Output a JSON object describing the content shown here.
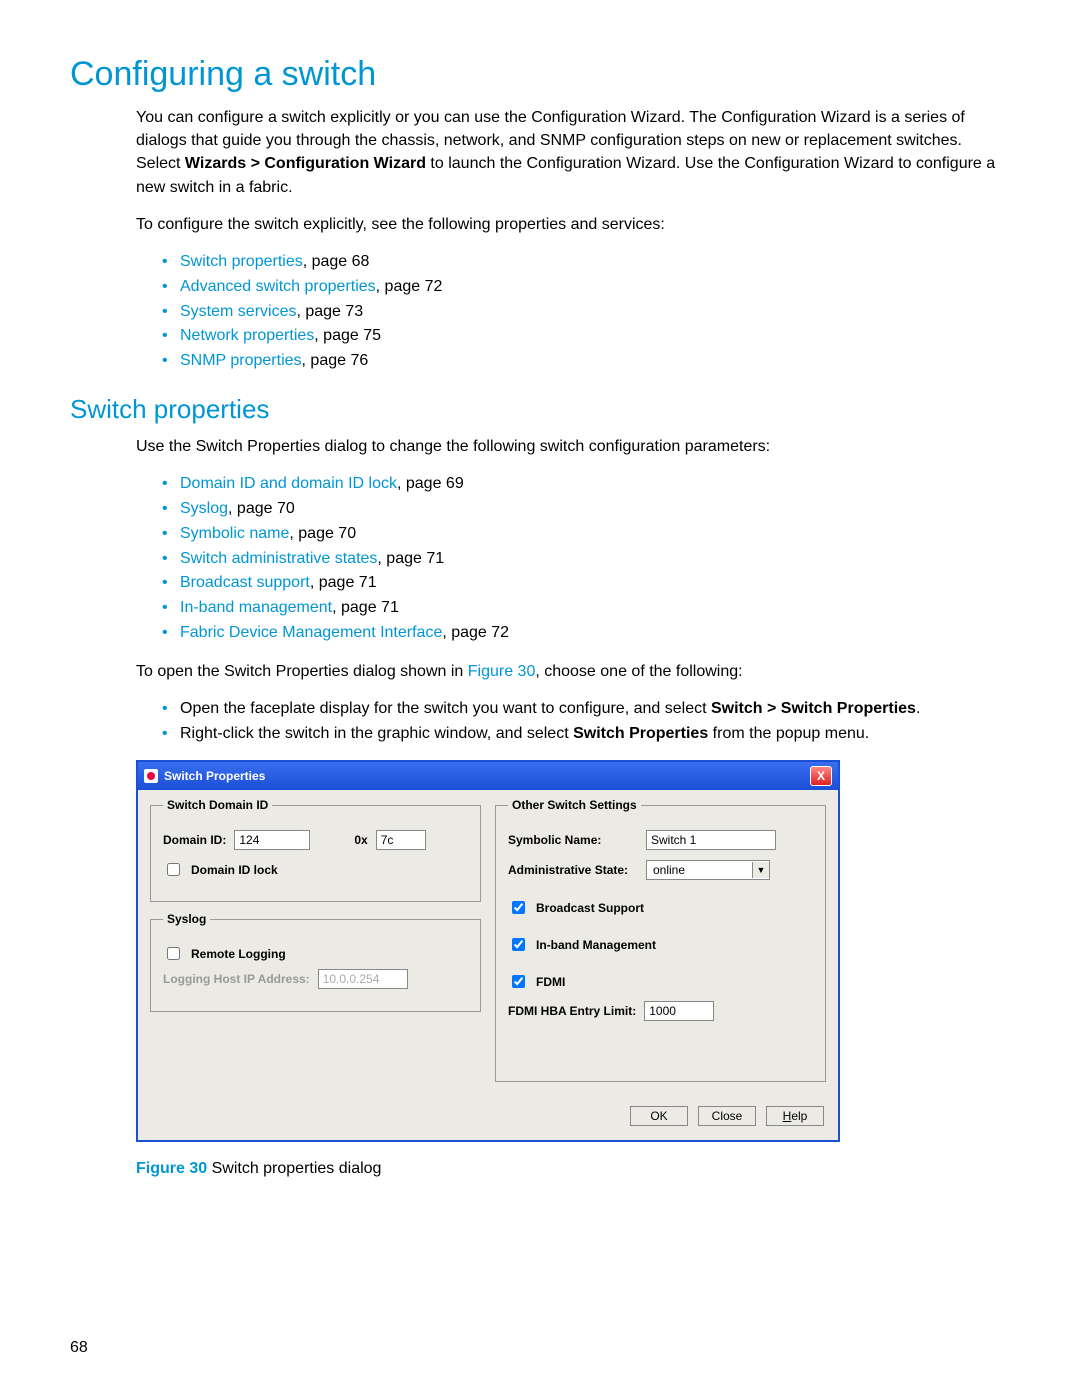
{
  "page_number": "68",
  "h1": "Configuring a switch",
  "intro_para_parts": {
    "a": "You can configure a switch explicitly or you can use the Configuration Wizard. The Configuration Wizard is a series of dialogs that guide you through the chassis, network, and SNMP configuration steps on new or replacement switches. Select ",
    "b_bold": "Wizards > Configuration Wizard",
    "c": " to launch the Configuration Wizard. Use the Configuration Wizard to configure a new switch in a fabric."
  },
  "intro_para2": "To configure the switch explicitly, see the following properties and services:",
  "links1": [
    {
      "t": "Switch properties",
      "p": ", page 68"
    },
    {
      "t": "Advanced switch properties",
      "p": ", page 72"
    },
    {
      "t": "System services",
      "p": ", page 73"
    },
    {
      "t": "Network properties",
      "p": ", page 75"
    },
    {
      "t": "SNMP properties",
      "p": ", page 76"
    }
  ],
  "h2": "Switch properties",
  "sp_intro": "Use the Switch Properties dialog to change the following switch configuration parameters:",
  "links2": [
    {
      "t": "Domain ID and domain ID lock",
      "p": ", page 69"
    },
    {
      "t": "Syslog",
      "p": ", page 70"
    },
    {
      "t": "Symbolic name",
      "p": ", page 70"
    },
    {
      "t": "Switch administrative states",
      "p": ", page 71"
    },
    {
      "t": "Broadcast support",
      "p": ", page 71"
    },
    {
      "t": "In-band management",
      "p": ", page 71"
    },
    {
      "t": "Fabric Device Management Interface",
      "p": ", page 72"
    }
  ],
  "open_para": {
    "a": "To open the Switch Properties dialog shown in ",
    "fig": "Figure 30",
    "b": ", choose one of the following:"
  },
  "open_steps": [
    {
      "a": "Open the faceplate display for the switch you want to configure, and select ",
      "bold": "Switch > Switch Properties",
      "b": "."
    },
    {
      "a": "Right-click the switch in the graphic window, and select ",
      "bold": "Switch Properties",
      "b": " from the popup menu."
    }
  ],
  "dialog": {
    "title": "Switch Properties",
    "close": "X",
    "left": {
      "domain_legend": "Switch Domain ID",
      "domain_id_lbl": "Domain ID:",
      "domain_id_val": "124",
      "hex_prefix": "0x",
      "hex_val": "7c",
      "domain_lock_lbl": "Domain ID lock",
      "domain_lock_checked": false,
      "syslog_legend": "Syslog",
      "remote_logging_lbl": "Remote Logging",
      "remote_logging_checked": false,
      "logging_ip_lbl": "Logging Host IP Address:",
      "logging_ip_val": "10.0.0.254"
    },
    "right": {
      "legend": "Other Switch Settings",
      "sym_name_lbl": "Symbolic Name:",
      "sym_name_val": "Switch 1",
      "admin_state_lbl": "Administrative State:",
      "admin_state_val": "online",
      "broadcast_lbl": "Broadcast Support",
      "broadcast_checked": true,
      "inband_lbl": "In-band Management",
      "inband_checked": true,
      "fdmi_lbl": "FDMI",
      "fdmi_checked": true,
      "fdmi_limit_lbl": "FDMI HBA Entry Limit:",
      "fdmi_limit_val": "1000"
    },
    "buttons": {
      "ok": "OK",
      "close": "Close",
      "help": "Help"
    }
  },
  "caption": {
    "fig": "Figure 30",
    "text": " Switch properties dialog"
  }
}
